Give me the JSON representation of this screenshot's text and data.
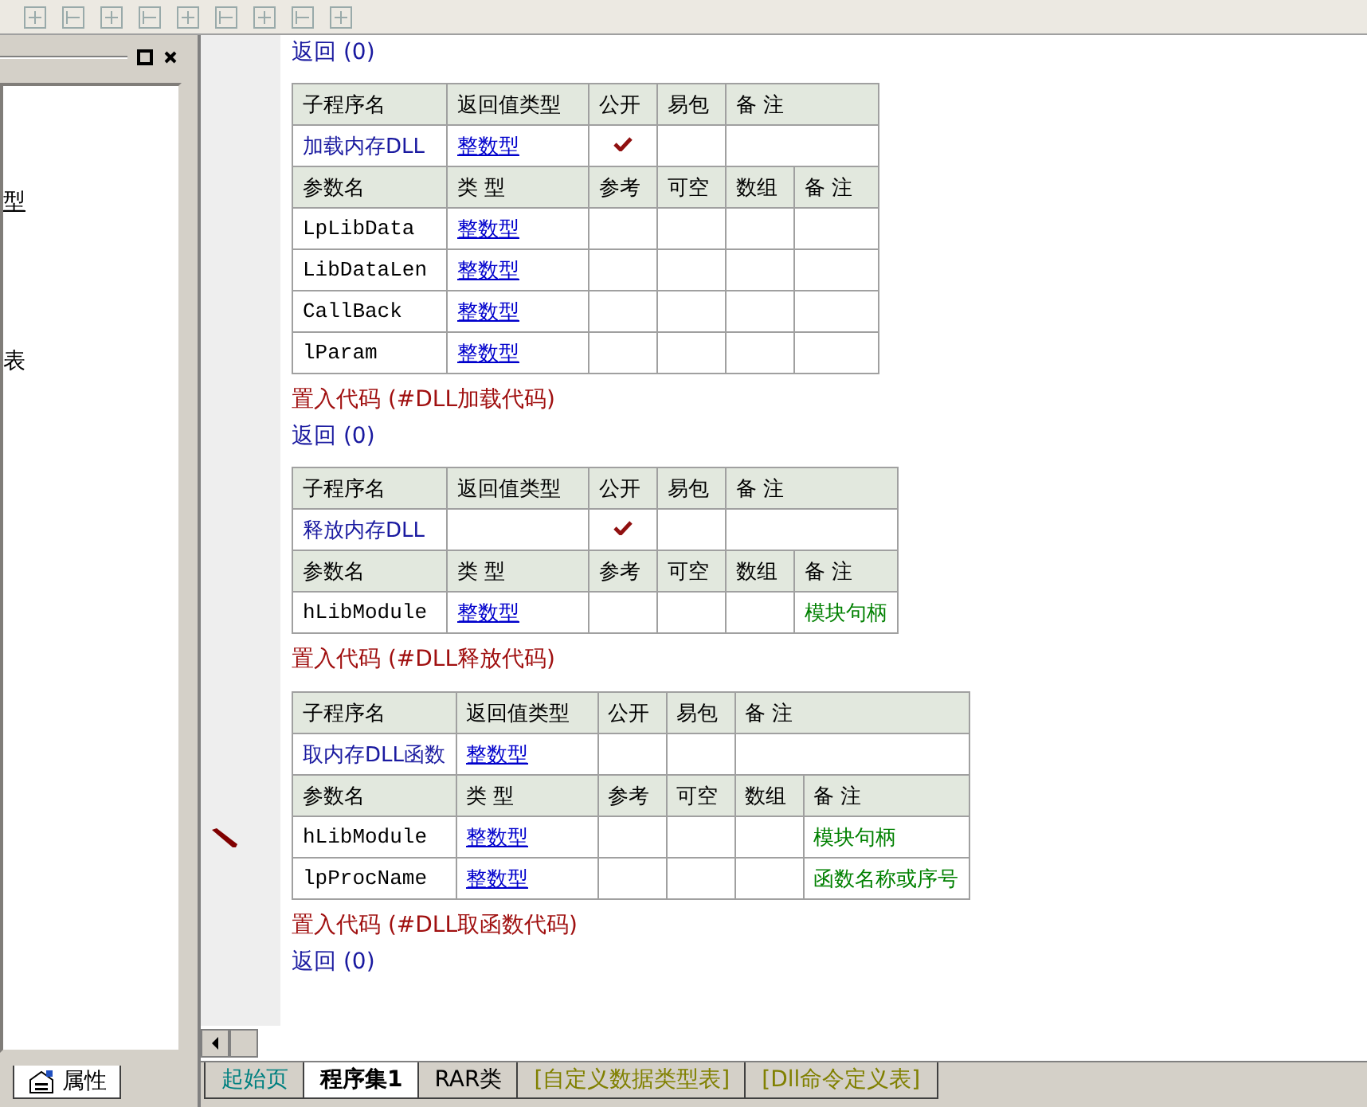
{
  "left_panel": {
    "items": [
      "型",
      "表"
    ],
    "tab": "属性"
  },
  "blocks": [
    {
      "kind": "return",
      "text": "返回 (0)"
    },
    {
      "kind": "table",
      "head": [
        "子程序名",
        "返回值类型",
        "公开",
        "易包",
        "备 注"
      ],
      "sub": {
        "name": "加载内存DLL",
        "return_type": "整数型",
        "public": true
      },
      "param_head": [
        "参数名",
        "类 型",
        "参考",
        "可空",
        "数组",
        "备 注"
      ],
      "params": [
        {
          "name": "LpLibData",
          "type": "整数型",
          "current": false
        },
        {
          "name": "LibDataLen",
          "type": "整数型",
          "current": false
        },
        {
          "name": "CallBack",
          "type": "整数型",
          "current": false
        },
        {
          "name": "lParam",
          "type": "整数型",
          "current": false
        }
      ]
    },
    {
      "kind": "code",
      "text": "置入代码 (#DLL加载代码)"
    },
    {
      "kind": "return",
      "text": "返回 (0)"
    },
    {
      "kind": "table",
      "head": [
        "子程序名",
        "返回值类型",
        "公开",
        "易包",
        "备 注"
      ],
      "sub": {
        "name": "释放内存DLL",
        "public": true
      },
      "param_head": [
        "参数名",
        "类 型",
        "参考",
        "可空",
        "数组",
        "备 注"
      ],
      "params": [
        {
          "name": "hLibModule",
          "type": "整数型",
          "note": "模块句柄",
          "current": false
        }
      ]
    },
    {
      "kind": "code",
      "text": "置入代码 (#DLL释放代码)"
    },
    {
      "kind": "table",
      "head": [
        "子程序名",
        "返回值类型",
        "公开",
        "易包",
        "备 注"
      ],
      "sub": {
        "name": "取内存DLL函数",
        "return_type": "整数型",
        "public": false
      },
      "param_head": [
        "参数名",
        "类 型",
        "参考",
        "可空",
        "数组",
        "备 注"
      ],
      "params": [
        {
          "name": "hLibModule",
          "type": "整数型",
          "note": "模块句柄",
          "current": true
        },
        {
          "name": "lpProcName",
          "type": "整数型",
          "note": "函数名称或序号",
          "current": false
        }
      ]
    },
    {
      "kind": "code",
      "text": "置入代码 (#DLL取函数代码)"
    },
    {
      "kind": "return",
      "text": "返回 (0)"
    }
  ],
  "tabs": [
    {
      "label": "起始页",
      "selected": false,
      "color": "#008080"
    },
    {
      "label": "程序集1",
      "selected": true,
      "color": "#000000"
    },
    {
      "label": "RAR类",
      "selected": false,
      "color": "#000000"
    },
    {
      "label": "[自定义数据类型表]",
      "selected": false,
      "color": "#808000"
    },
    {
      "label": "[Dll命令定义表]",
      "selected": false,
      "color": "#808000"
    }
  ]
}
